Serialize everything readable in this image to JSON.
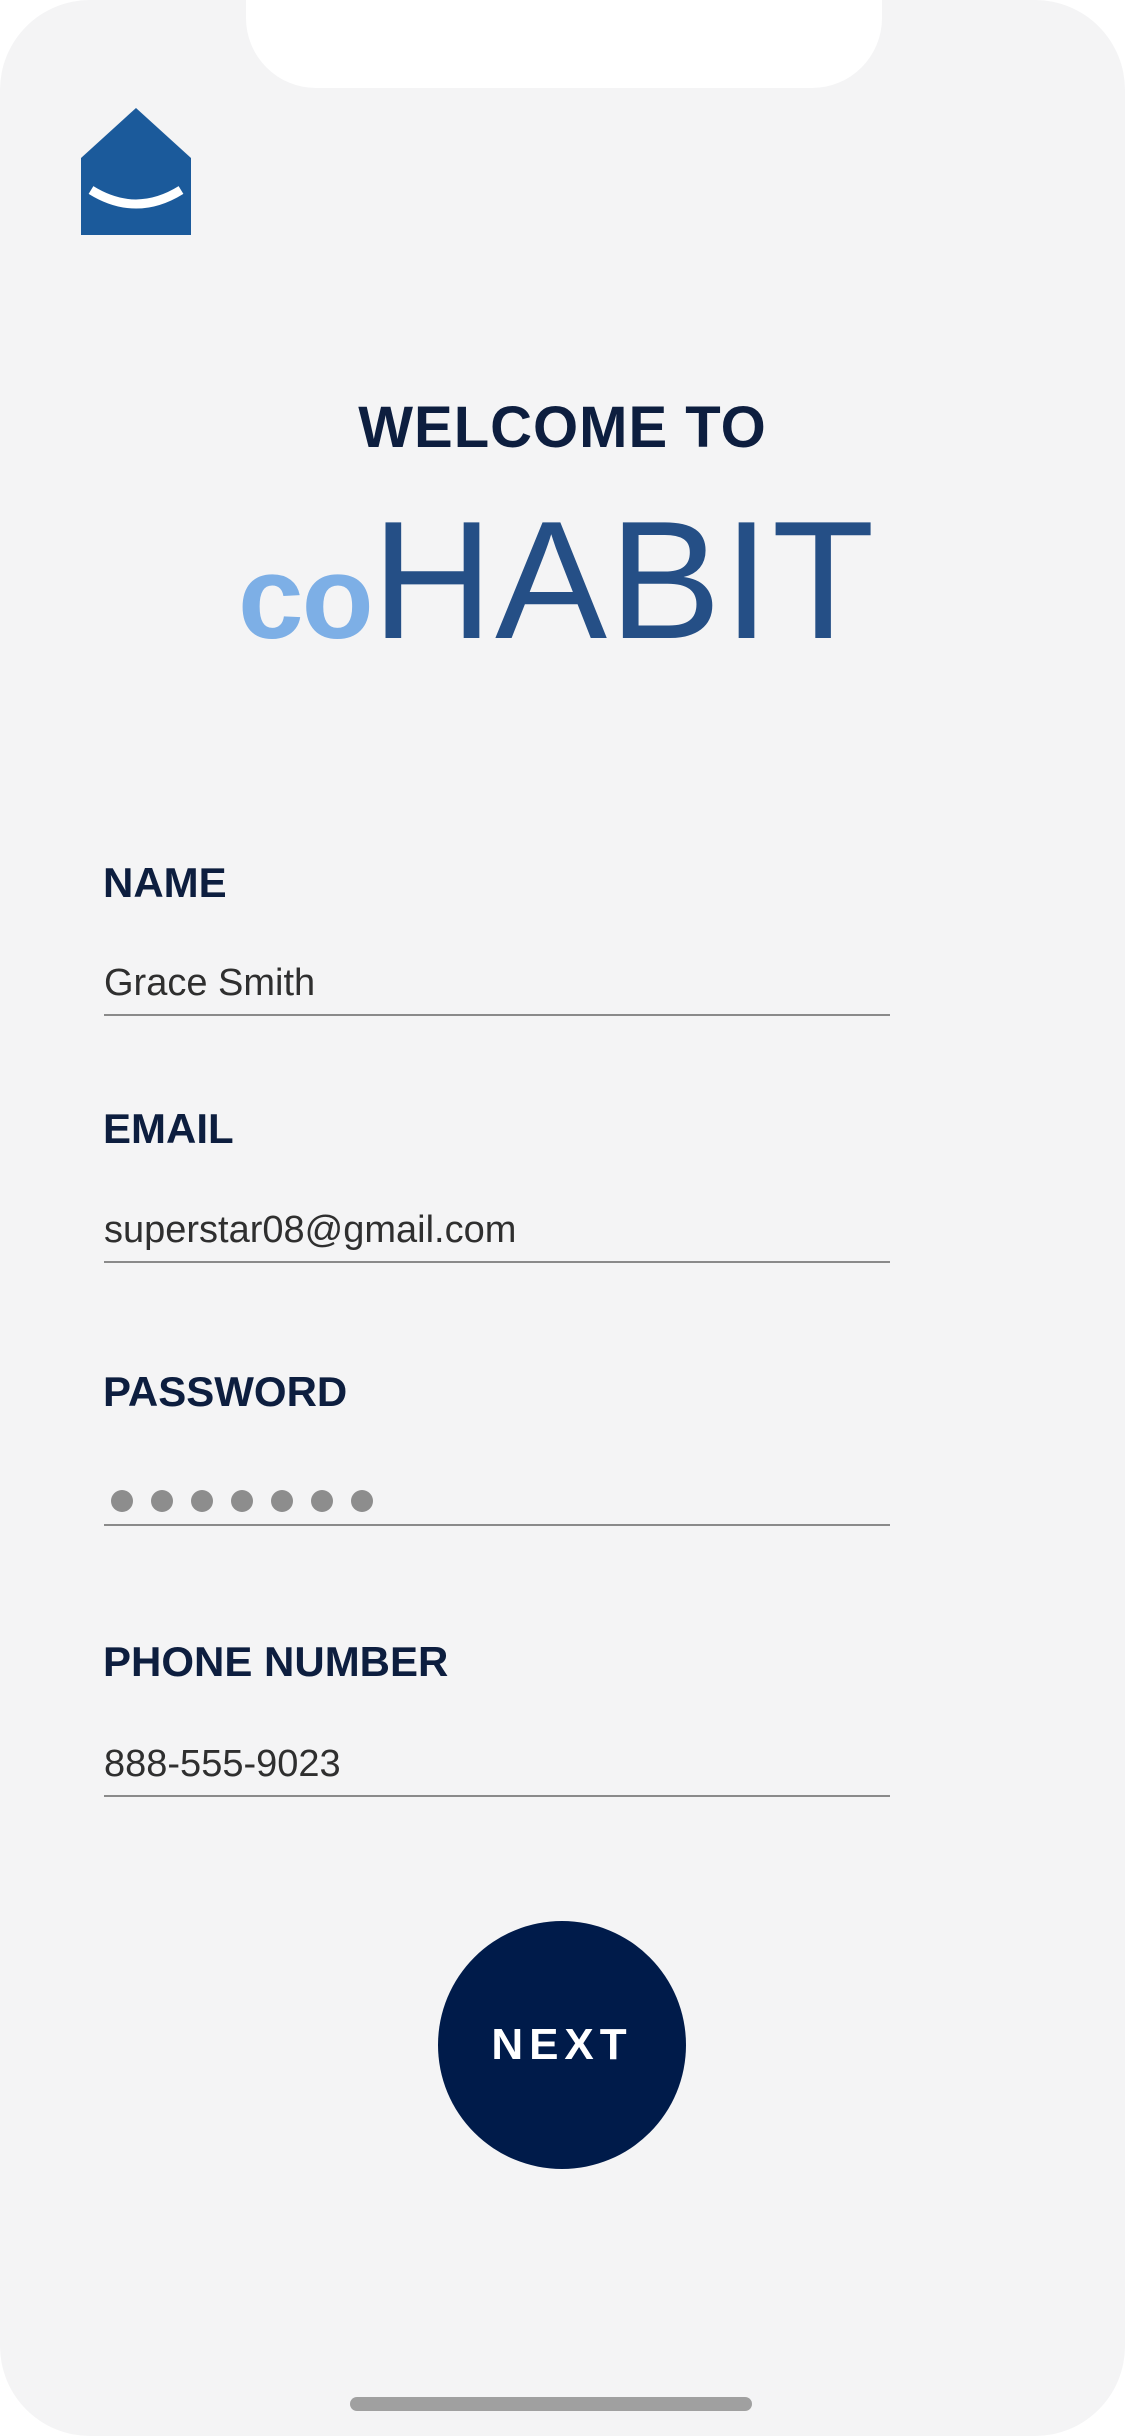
{
  "header": {
    "welcome": "WELCOME TO",
    "brand_co": "co",
    "brand_habit": "HABIT"
  },
  "form": {
    "name_label": "NAME",
    "name_value": "Grace Smith",
    "email_label": "EMAIL",
    "email_value": "superstar08@gmail.com",
    "password_label": "PASSWORD",
    "password_masked_length": 7,
    "phone_label": "PHONE NUMBER",
    "phone_value": "888-555-9023"
  },
  "actions": {
    "next_label": "NEXT"
  },
  "colors": {
    "background": "#f4f4f5",
    "logo_blue": "#1b5a9b",
    "brand_light_blue": "#7dafe6",
    "brand_dark_blue": "#254f86",
    "label_navy": "#0d1e3f",
    "button_navy": "#001b4a"
  },
  "icons": {
    "logo": "house-smile-icon"
  }
}
